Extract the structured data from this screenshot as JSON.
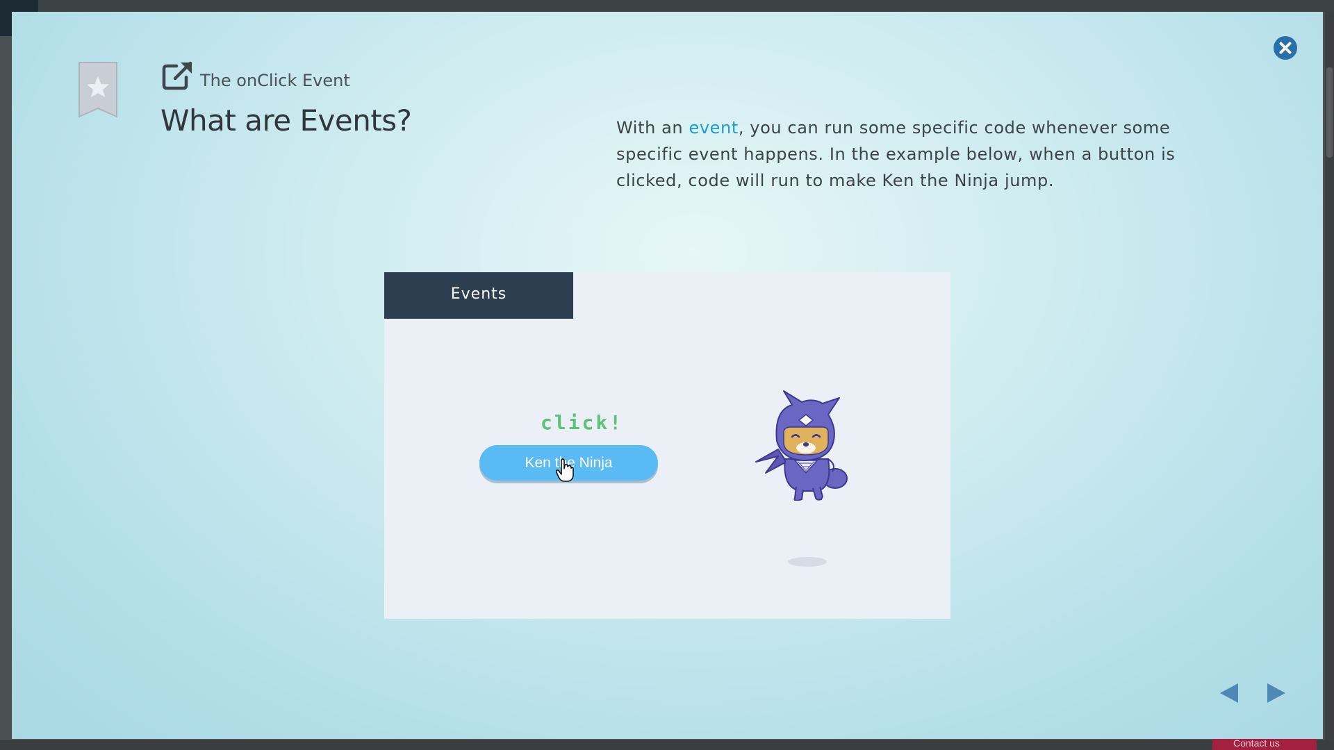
{
  "lesson": {
    "subtitle": "The onClick Event",
    "title": "What are Events?",
    "description_before": "With an ",
    "description_link": "event",
    "description_after": ", you can run some specific code whenever some specific event happens. In the example below, when a button is clicked, code will run to make Ken the Ninja jump."
  },
  "demo": {
    "tab_label": "Events",
    "click_label": "click!",
    "button_label": "Ken the Ninja",
    "ninja_icon": "ninja-character-icon"
  },
  "background": {
    "contact_label": "Contact us"
  },
  "icons": {
    "bookmark": "bookmark-star-icon",
    "external": "external-link-icon",
    "close": "close-icon",
    "prev": "triangle-left-icon",
    "next": "triangle-right-icon"
  },
  "colors": {
    "accent": "#1a9fcb",
    "close": "#2a6fa7",
    "demo_tab": "#2c3e50",
    "demo_button": "#5abbf4",
    "click_text": "#5cc17b",
    "ninja": "#6a67c3"
  }
}
